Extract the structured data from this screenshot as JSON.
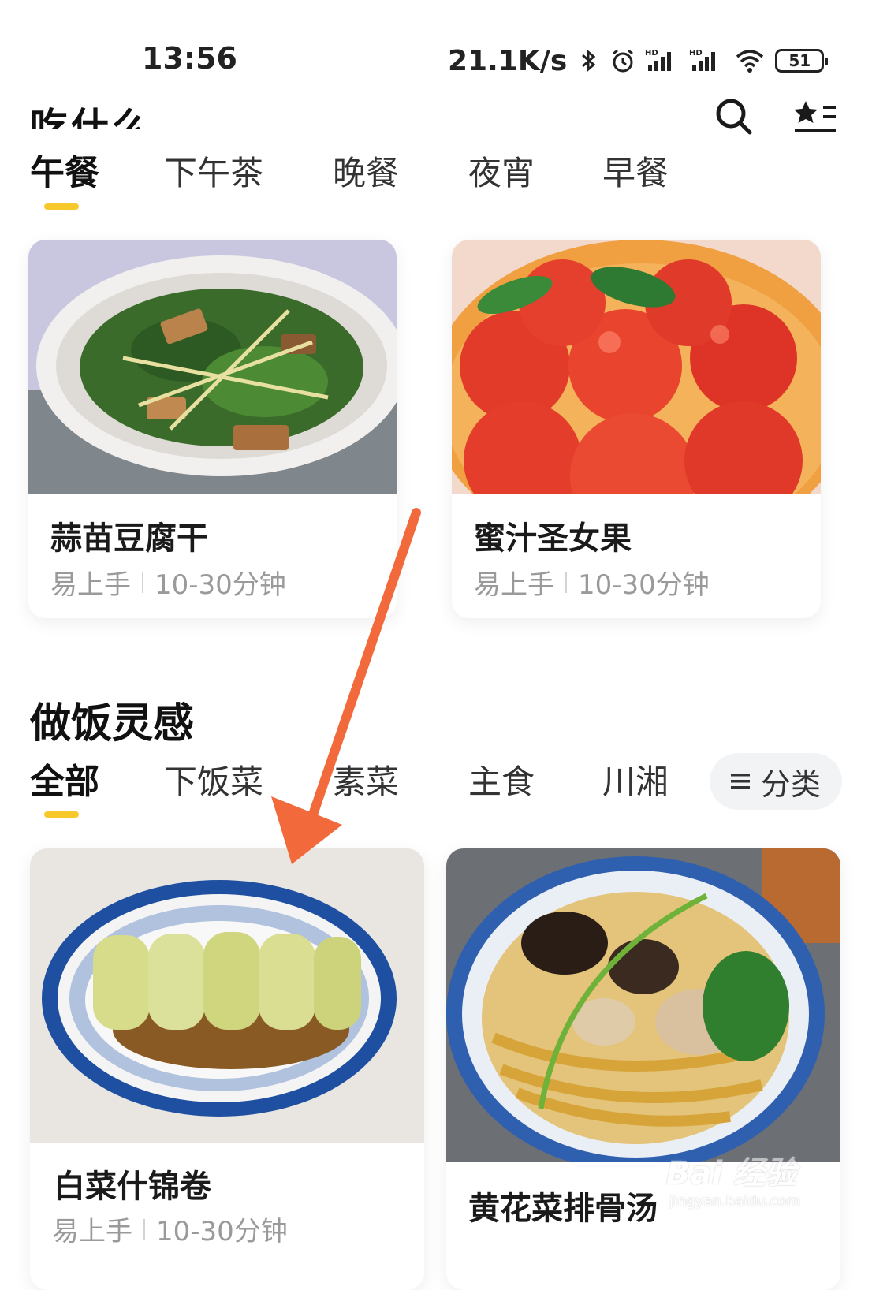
{
  "status": {
    "time": "13:56",
    "speed": "21.1K/s",
    "battery": "51",
    "icons": [
      "bluetooth-icon",
      "alarm-icon",
      "signal-hd-icon",
      "signal-hd-icon",
      "wifi-icon",
      "battery-icon"
    ]
  },
  "header": {
    "title": "吃什么",
    "search_icon": "search-icon",
    "fav_icon": "star-list-icon"
  },
  "meal_tabs": [
    "午餐",
    "下午茶",
    "晚餐",
    "夜宵",
    "早餐"
  ],
  "meal_active_index": 0,
  "featured": [
    {
      "title": "蒜苗豆腐干",
      "difficulty": "易上手",
      "time": "10-30分钟"
    },
    {
      "title": "蜜汁圣女果",
      "difficulty": "易上手",
      "time": "10-30分钟"
    }
  ],
  "section": {
    "title": "做饭灵感",
    "tabs": [
      "全部",
      "下饭菜",
      "素菜",
      "主食",
      "川湘"
    ],
    "active_index": 0,
    "category_button": "分类"
  },
  "recipes": [
    {
      "title": "白菜什锦卷",
      "difficulty": "易上手",
      "time": "10-30分钟"
    },
    {
      "title": "黄花菜排骨汤"
    }
  ],
  "watermark": {
    "main": "Bai 经验",
    "sub": "jingyan.baidu.com"
  },
  "colors": {
    "accent": "#f7c829",
    "annotation_arrow": "#f26a3b"
  }
}
